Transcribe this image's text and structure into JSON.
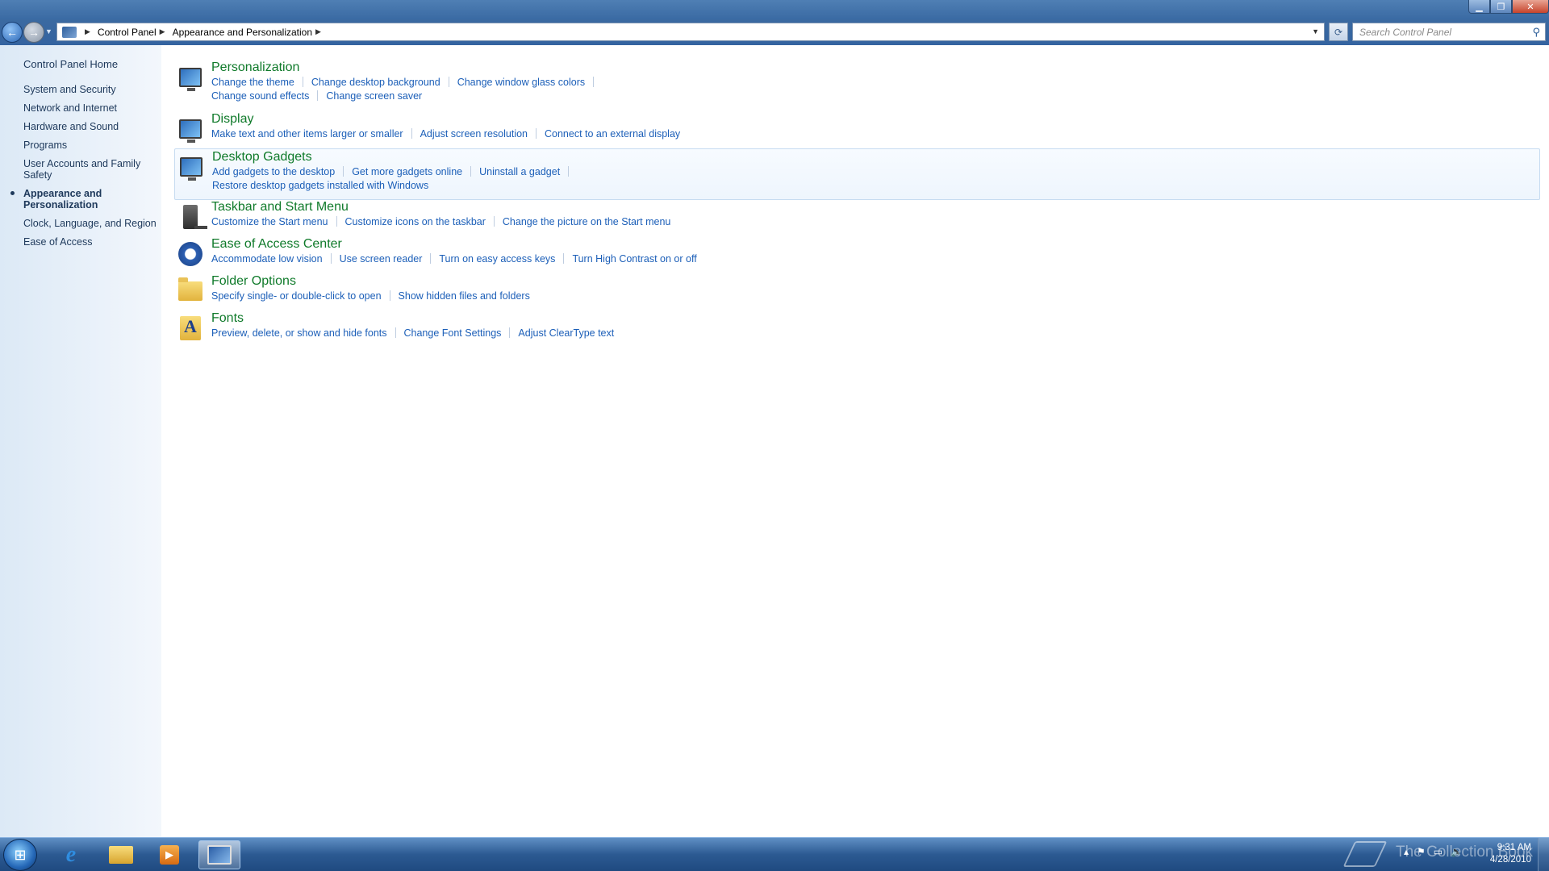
{
  "window": {
    "controls": {
      "minimize": "▁",
      "maximize": "❐",
      "close": "✕"
    }
  },
  "address": {
    "crumbs": [
      "Control Panel",
      "Appearance and Personalization"
    ],
    "refresh_glyph": "⟳",
    "search_placeholder": "Search Control Panel"
  },
  "sidebar": {
    "home": "Control Panel Home",
    "items": [
      {
        "label": "System and Security"
      },
      {
        "label": "Network and Internet"
      },
      {
        "label": "Hardware and Sound"
      },
      {
        "label": "Programs"
      },
      {
        "label": "User Accounts and Family Safety"
      },
      {
        "label": "Appearance and Personalization",
        "active": true
      },
      {
        "label": "Clock, Language, and Region"
      },
      {
        "label": "Ease of Access"
      }
    ]
  },
  "categories": [
    {
      "title": "Personalization",
      "icon": "personalization-icon",
      "links": [
        "Change the theme",
        "Change desktop background",
        "Change window glass colors",
        "Change sound effects",
        "Change screen saver"
      ]
    },
    {
      "title": "Display",
      "icon": "display-icon",
      "links": [
        "Make text and other items larger or smaller",
        "Adjust screen resolution",
        "Connect to an external display"
      ]
    },
    {
      "title": "Desktop Gadgets",
      "icon": "desktop-gadgets-icon",
      "links": [
        "Add gadgets to the desktop",
        "Get more gadgets online",
        "Uninstall a gadget",
        "Restore desktop gadgets installed with Windows"
      ]
    },
    {
      "title": "Taskbar and Start Menu",
      "icon": "taskbar-icon",
      "links": [
        "Customize the Start menu",
        "Customize icons on the taskbar",
        "Change the picture on the Start menu"
      ]
    },
    {
      "title": "Ease of Access Center",
      "icon": "ease-of-access-icon",
      "links": [
        "Accommodate low vision",
        "Use screen reader",
        "Turn on easy access keys",
        "Turn High Contrast on or off"
      ]
    },
    {
      "title": "Folder Options",
      "icon": "folder-options-icon",
      "links": [
        "Specify single- or double-click to open",
        "Show hidden files and folders"
      ]
    },
    {
      "title": "Fonts",
      "icon": "fonts-icon",
      "links": [
        "Preview, delete, or show and hide fonts",
        "Change Font Settings",
        "Adjust ClearType text"
      ]
    }
  ],
  "taskbar": {
    "watermark": "The Collection Book",
    "time": "9:31 AM",
    "date": "4/28/2010",
    "ie_glyph": "e",
    "media_glyph": "▶",
    "start_glyph": "⊞",
    "tray_glyphs": [
      "▴",
      "⚑",
      "▭",
      "🔈"
    ]
  }
}
